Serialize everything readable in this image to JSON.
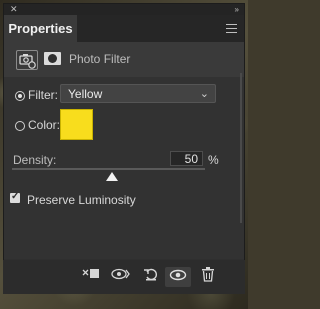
{
  "panel": {
    "tab_label": "Properties",
    "adjustment_name": "Photo Filter"
  },
  "filter": {
    "label": "Filter:",
    "selected": "Yellow"
  },
  "color": {
    "label": "Color:",
    "swatch": "#f8dd1d"
  },
  "density": {
    "label": "Density:",
    "value": "50",
    "unit": "%"
  },
  "preserve": {
    "label": "Preserve Luminosity"
  },
  "footer_icons": [
    "clip-to-layer-icon",
    "view-previous-state-icon",
    "reset-icon",
    "visibility-eye-icon",
    "trash-icon"
  ]
}
